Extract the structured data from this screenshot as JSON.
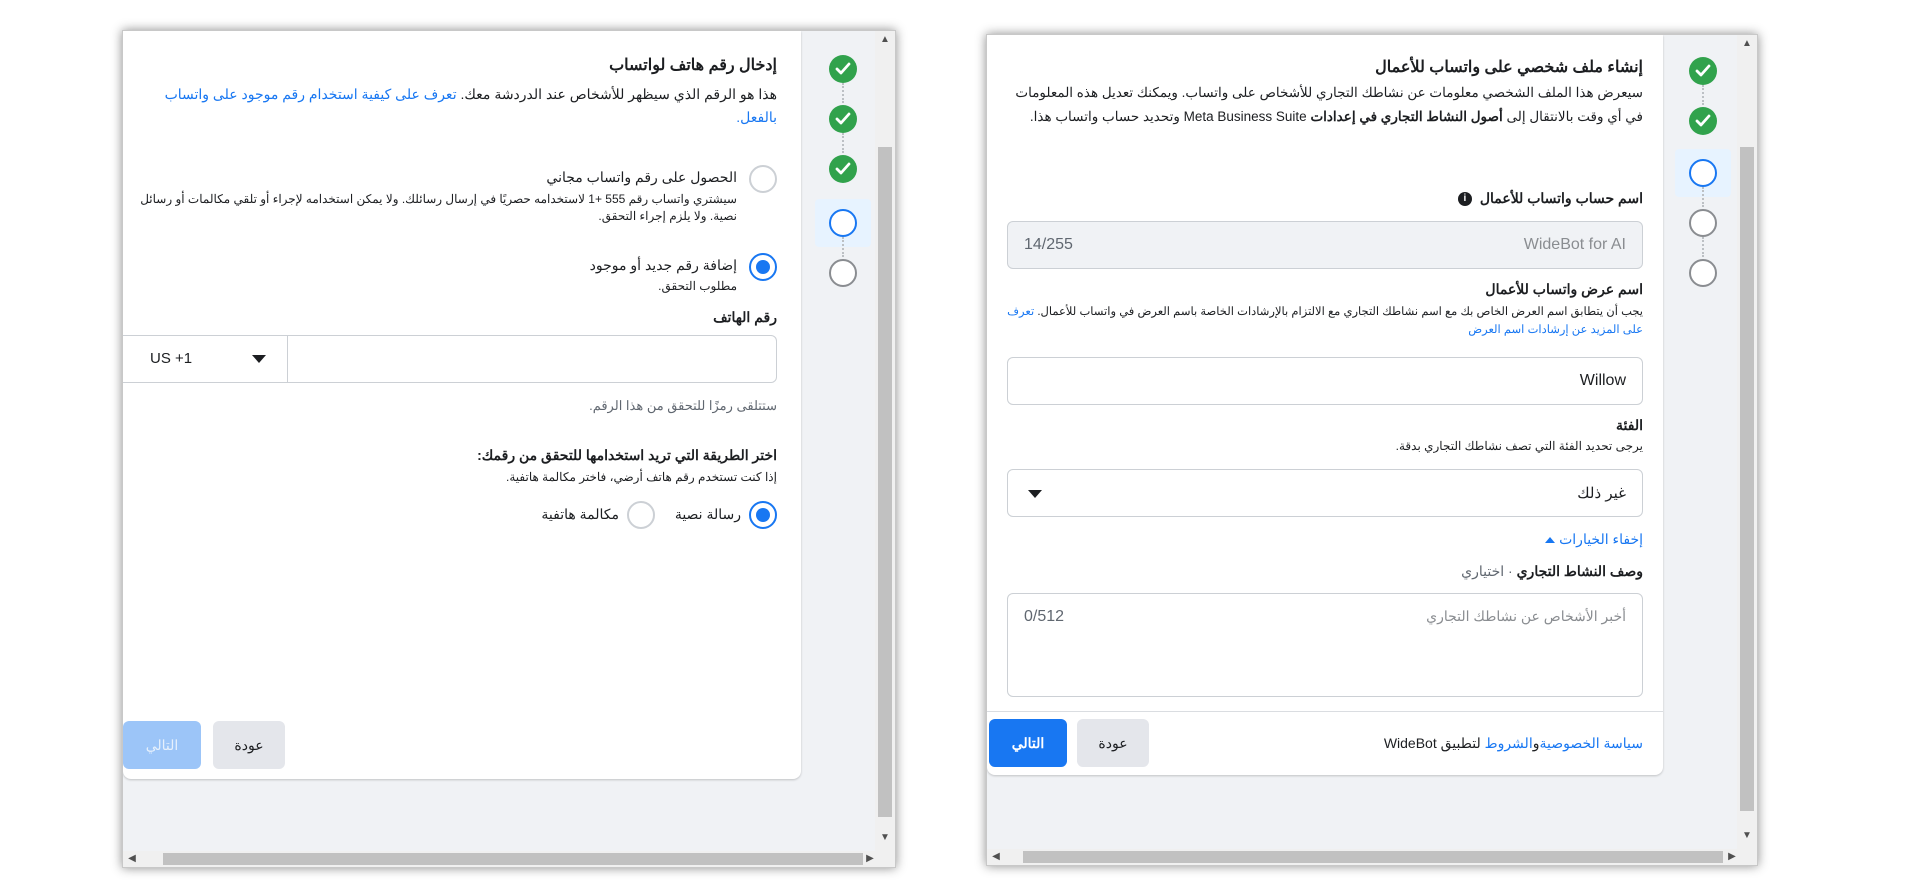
{
  "left": {
    "title": "إدخال رقم هاتف لواتساب",
    "desc_text": "هذا هو الرقم الذي سيظهر للأشخاص عند الدردشة معك.",
    "desc_link": "تعرف على كيفية استخدام رقم موجود على واتساب بالفعل.",
    "option_free_label": "الحصول على رقم واتساب مجاني",
    "option_free_desc": "سيشتري واتساب رقم 555 +1 لاستخدامه حصريًا في إرسال رسائلك. ولا يمكن استخدامه لإجراء أو تلقي مكالمات أو رسائل نصية. ولا يلزم إجراء التحقق.",
    "option_new_label": "إضافة رقم جديد أو موجود",
    "option_new_desc": "مطلوب التحقق.",
    "phone_label": "رقم الهاتف",
    "country_code": "US +1",
    "phone_hint": "ستتلقى رمزًا للتحقق من هذا الرقم.",
    "verify_title": "اختر الطريقة التي تريد استخدامها للتحقق من رقمك:",
    "verify_desc": "إذا كنت تستخدم رقم هاتف أرضي، فاختر مكالمة هاتفية.",
    "method_sms": "رسالة نصية",
    "method_call": "مكالمة هاتفية",
    "back": "عودة",
    "next": "التالي"
  },
  "right": {
    "title": "إنشاء ملف شخصي على واتساب للأعمال",
    "desc_1": "سيعرض هذا الملف الشخصي معلومات عن نشاطك التجاري للأشخاص على واتساب. ويمكنك تعديل هذه المعلومات في أي وقت بالانتقال إلى",
    "desc_bold": "أصول النشاط التجاري في إعدادات",
    "desc_2": "Meta Business Suite وتحديد حساب واتساب هذا.",
    "account_name_label": "اسم حساب واتساب للأعمال",
    "account_name_value": "WideBot for AI",
    "account_name_count": "14/255",
    "display_name_label": "اسم عرض واتساب للأعمال",
    "display_name_desc": "يجب أن يتطابق اسم العرض الخاص بك مع اسم نشاطك التجاري مع الالتزام بالإرشادات الخاصة باسم العرض في واتساب للأعمال.",
    "display_name_link": "تعرف على المزيد عن إرشادات اسم العرض",
    "display_name_value": "Willow",
    "category_label": "الفئة",
    "category_desc": "يرجى تحديد الفئة التي تصف نشاطك التجاري بدقة.",
    "category_value": "غير ذلك",
    "hide_options": "إخفاء الخيارات",
    "business_desc_label": "وصف النشاط التجاري",
    "business_desc_optional": "· اختياري",
    "business_desc_placeholder": "أخبر الأشخاص عن نشاطك التجاري",
    "business_desc_count": "0/512",
    "footer_privacy": "سياسة الخصوصية",
    "footer_and": "و",
    "footer_terms": "الشروط",
    "footer_app": "لتطبيق WideBot",
    "back": "عودة",
    "next": "التالي"
  },
  "icons": {
    "check": "check-icon",
    "info": "info-icon",
    "dropdown": "caret-down-icon",
    "scroll_up": "arrow-up-icon",
    "scroll_down": "arrow-down-icon",
    "scroll_left": "arrow-left-icon",
    "scroll_right": "arrow-right-icon"
  },
  "colors": {
    "primary": "#1877f2",
    "success": "#31a24c",
    "background": "#f0f2f5"
  }
}
